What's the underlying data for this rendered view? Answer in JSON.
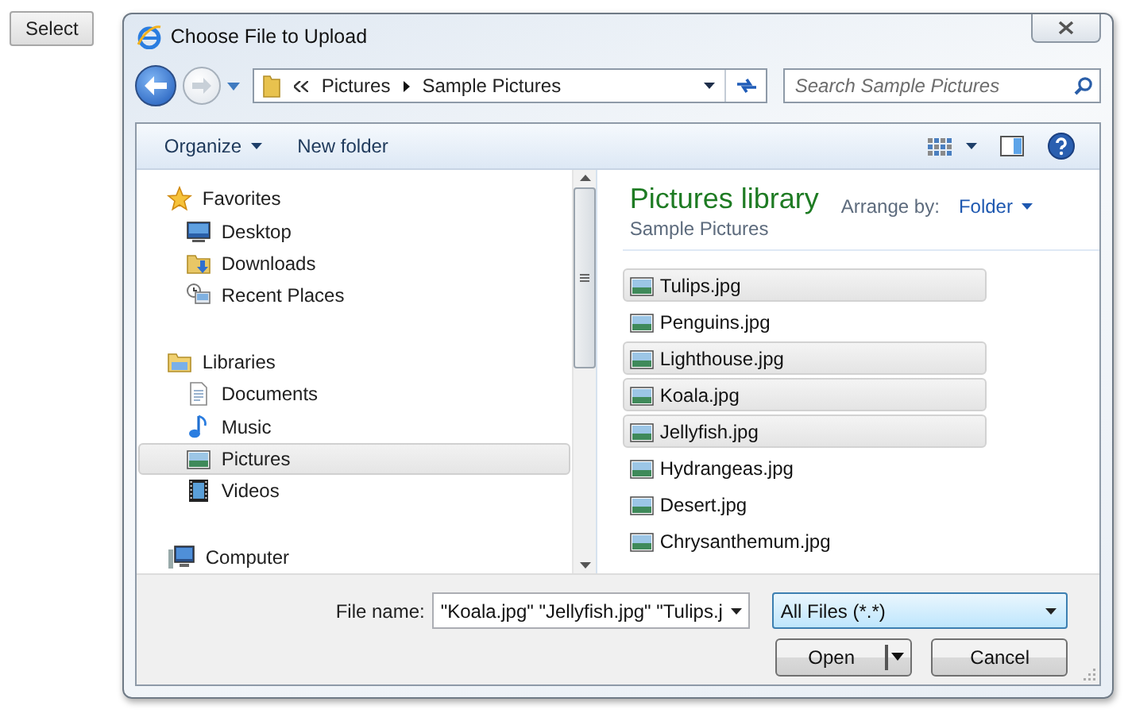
{
  "page": {
    "select_button": "Select"
  },
  "window": {
    "title": "Choose File to Upload"
  },
  "address_bar": {
    "breadcrumbs": [
      "Pictures",
      "Sample Pictures"
    ]
  },
  "search": {
    "placeholder": "Search Sample Pictures"
  },
  "toolbar": {
    "organize": "Organize",
    "new_folder": "New folder"
  },
  "navigation": [
    {
      "label": "Favorites",
      "selected": false,
      "children": [
        {
          "label": "Desktop",
          "selected": false
        },
        {
          "label": "Downloads",
          "selected": false
        },
        {
          "label": "Recent Places",
          "selected": false
        }
      ]
    },
    {
      "label": "Libraries",
      "selected": false,
      "children": [
        {
          "label": "Documents",
          "selected": false
        },
        {
          "label": "Music",
          "selected": false
        },
        {
          "label": "Pictures",
          "selected": true
        },
        {
          "label": "Videos",
          "selected": false
        }
      ]
    },
    {
      "label": "Computer",
      "selected": false
    }
  ],
  "library": {
    "title": "Pictures library",
    "subtitle": "Sample Pictures",
    "arrange_label": "Arrange by:",
    "arrange_value": "Folder"
  },
  "files": [
    {
      "name": "Tulips.jpg",
      "selected": true
    },
    {
      "name": "Penguins.jpg",
      "selected": false
    },
    {
      "name": "Lighthouse.jpg",
      "selected": true
    },
    {
      "name": "Koala.jpg",
      "selected": true
    },
    {
      "name": "Jellyfish.jpg",
      "selected": true
    },
    {
      "name": "Hydrangeas.jpg",
      "selected": false
    },
    {
      "name": "Desert.jpg",
      "selected": false
    },
    {
      "name": "Chrysanthemum.jpg",
      "selected": false
    }
  ],
  "file_name": {
    "label": "File name:",
    "value": "\"Koala.jpg\" \"Jellyfish.jpg\" \"Tulips.j"
  },
  "file_type": {
    "value": "All Files (*.*)"
  },
  "buttons": {
    "open": "Open",
    "cancel": "Cancel"
  }
}
